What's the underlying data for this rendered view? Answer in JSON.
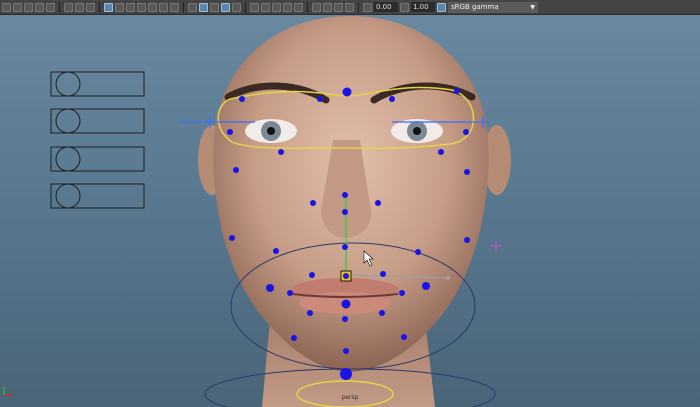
{
  "toolbar": {
    "exposure_value": "0.00",
    "gamma_value": "1.00",
    "color_space": "sRGB gamma"
  },
  "viewport": {
    "camera_label": "persp"
  },
  "colors": {
    "control_dot": "#1a14e6",
    "curve": "#e6d24a",
    "skin": "#c9a390"
  },
  "icons": [
    "select-tool-icon",
    "lasso-icon",
    "paint-icon",
    "move-icon",
    "rotate-icon",
    "scale-icon",
    "camera-icon",
    "grid-icon",
    "wireframe-icon",
    "shaded-icon",
    "textured-icon",
    "lights-icon",
    "shadows-icon",
    "isolate-icon",
    "xray-icon",
    "exposure-icon",
    "gamma-icon",
    "color-space-icon"
  ]
}
